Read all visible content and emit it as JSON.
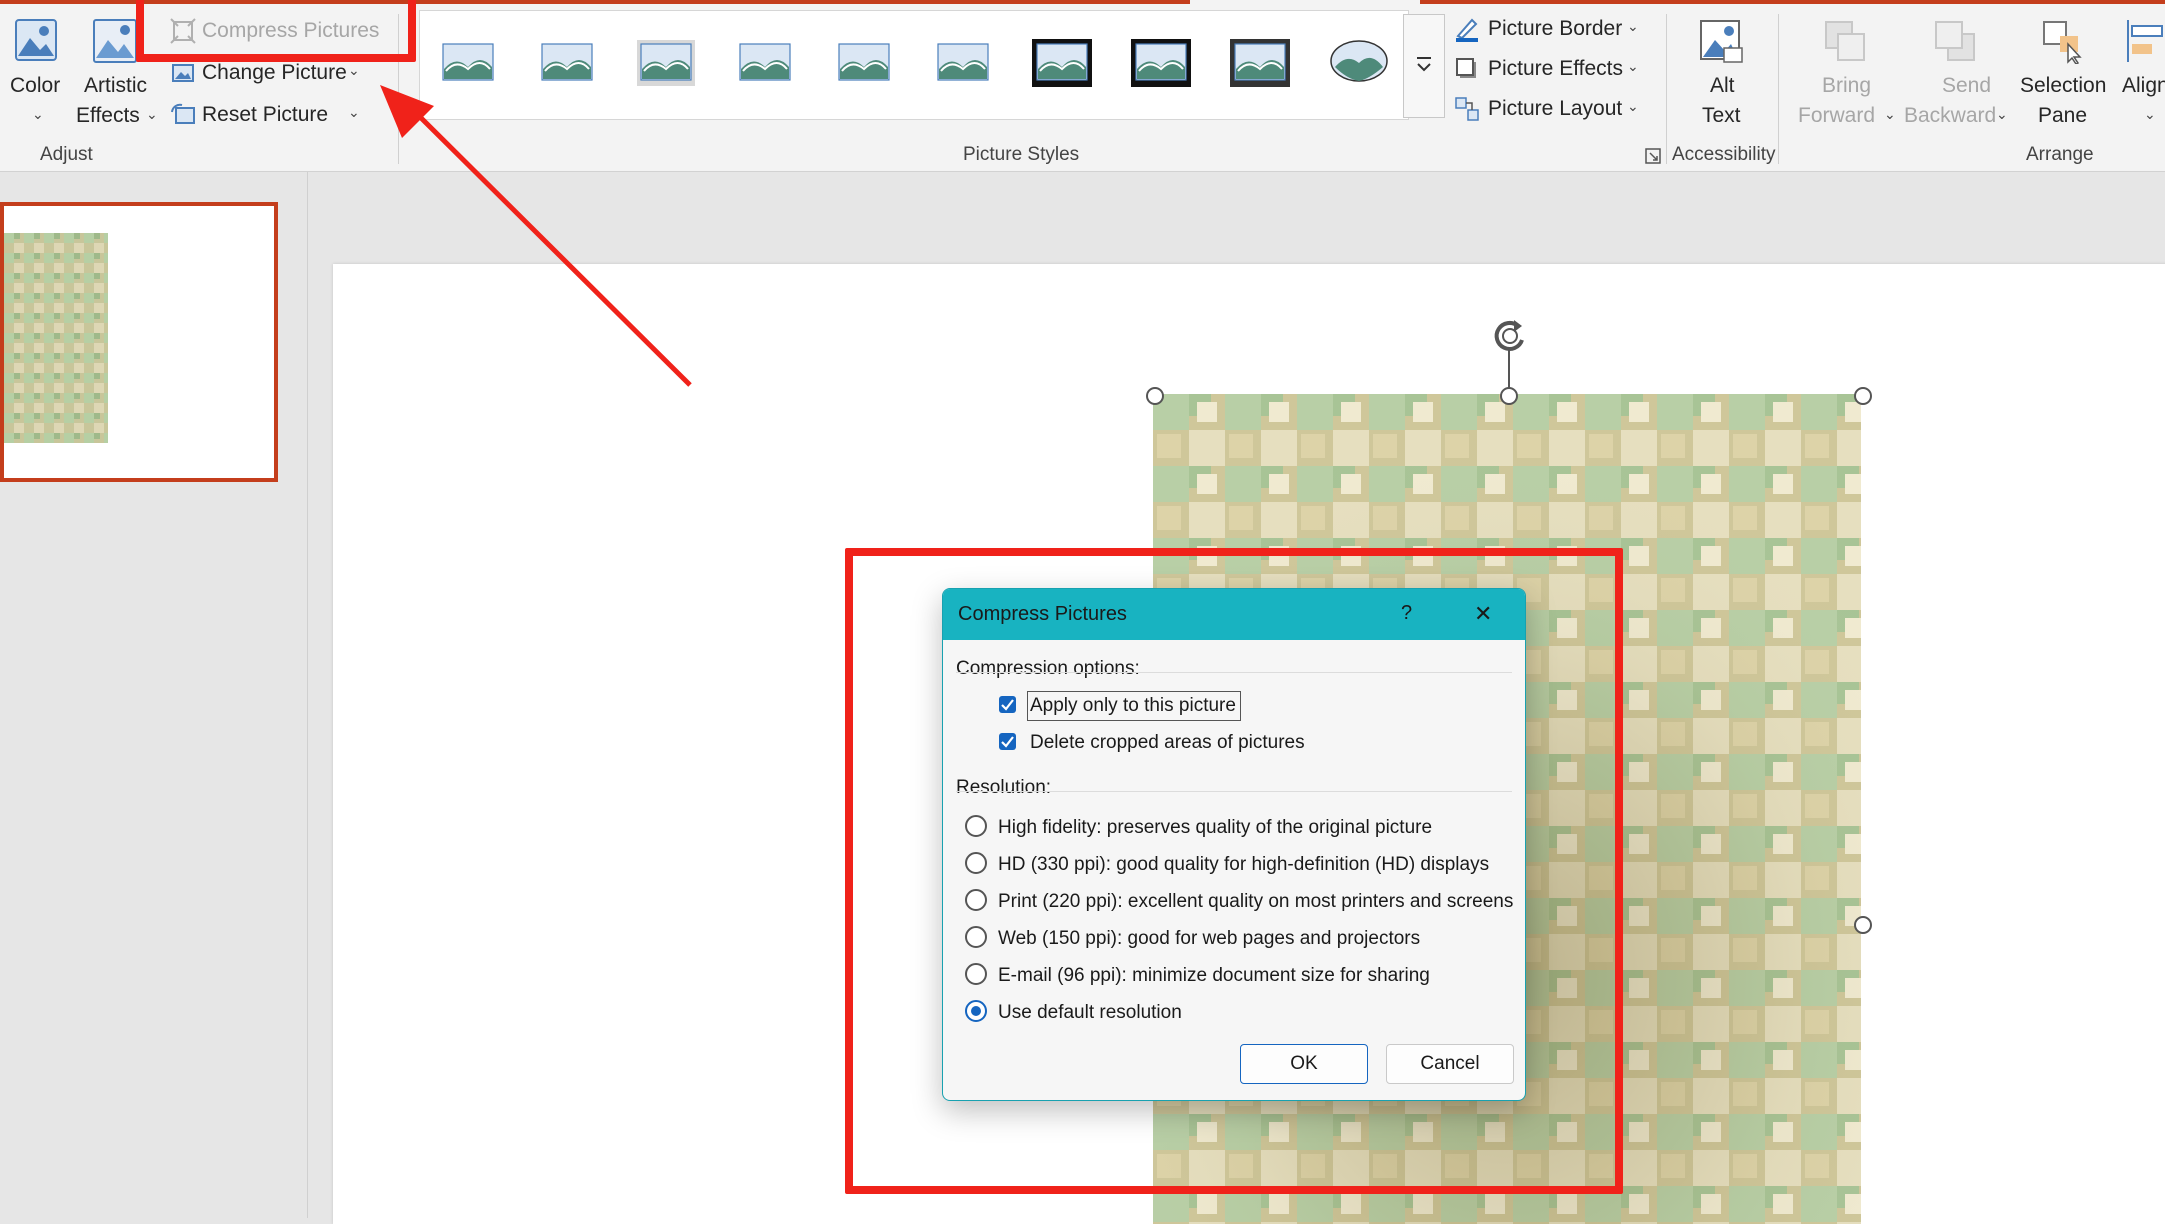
{
  "ribbon": {
    "adjust": {
      "color_label": "Color",
      "artistic_label_1": "Artistic",
      "artistic_label_2": "Effects",
      "compress_label": "Compress Pictures",
      "change_label": "Change Picture",
      "reset_label": "Reset Picture",
      "group_label": "Adjust"
    },
    "styles": {
      "group_label": "Picture Styles",
      "border_label": "Picture Border",
      "effects_label": "Picture Effects",
      "layout_label": "Picture Layout"
    },
    "accessibility": {
      "alt_text_1": "Alt",
      "alt_text_2": "Text",
      "group_label": "Accessibility"
    },
    "arrange": {
      "bring_forward_1": "Bring",
      "bring_forward_2": "Forward",
      "send_backward_1": "Send",
      "send_backward_2": "Backward",
      "selection_pane_1": "Selection",
      "selection_pane_2": "Pane",
      "align_label": "Align",
      "group_label": "Arrange"
    }
  },
  "dialog": {
    "title": "Compress Pictures",
    "help": "?",
    "close": "✕",
    "compression_heading": "Compression options:",
    "apply_only": "Apply only to this picture",
    "delete_cropped": "Delete cropped areas of pictures",
    "resolution_heading": "Resolution:",
    "options": [
      {
        "label": "High fidelity: preserves quality of the original picture",
        "selected": false
      },
      {
        "label": "HD (330 ppi): good quality for high-definition (HD) displays",
        "selected": false
      },
      {
        "label": "Print (220 ppi): excellent quality on most printers and screens",
        "selected": false
      },
      {
        "label": "Web (150 ppi): good for web pages and projectors",
        "selected": false
      },
      {
        "label": "E-mail (96 ppi): minimize document size for sharing",
        "selected": false
      },
      {
        "label": "Use default resolution",
        "selected": true
      }
    ],
    "ok": "OK",
    "cancel": "Cancel"
  },
  "colors": {
    "accent": "#c43e1c",
    "dialog_title": "#18b3c1",
    "checkbox": "#1565c0",
    "annotation_red": "#f0221a"
  }
}
